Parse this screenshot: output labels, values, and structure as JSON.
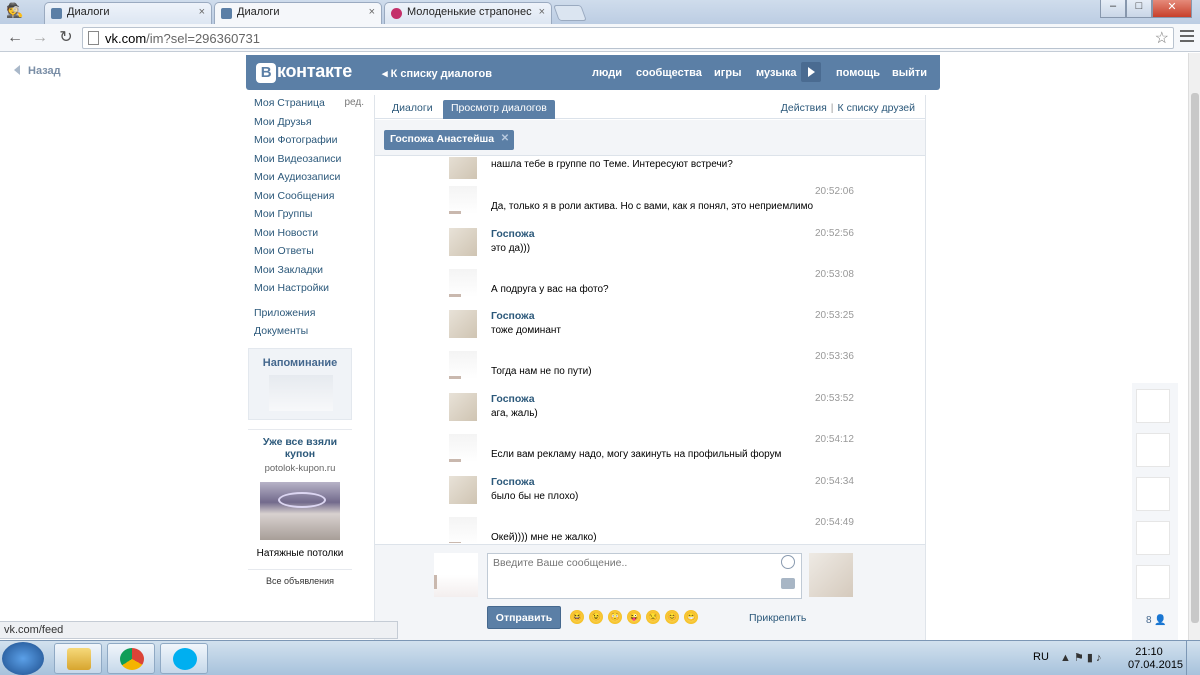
{
  "browser": {
    "tabs": [
      {
        "title": "Диалоги",
        "icon": "vk-favicon"
      },
      {
        "title": "Диалоги",
        "icon": "vk-favicon",
        "active": true
      },
      {
        "title": "Молоденькие страпонес",
        "icon": "pink-favicon"
      }
    ],
    "tab_close": "×",
    "url_host": "vk.com",
    "url_rest": "/im?sel=296360731",
    "window_controls": {
      "minimize": "–",
      "maximize": "□",
      "close": "✕"
    }
  },
  "page": {
    "back_label": "Назад",
    "header": {
      "logo_letter": "B",
      "logo_text": "контакте",
      "back_to_dialogs": "К списку диалогов",
      "links": [
        "люди",
        "сообщества",
        "игры",
        "музыка",
        "помощь",
        "выйти"
      ]
    },
    "sidebar": {
      "items": [
        "Моя Страница",
        "Мои Друзья",
        "Мои Фотографии",
        "Мои Видеозаписи",
        "Мои Аудиозаписи",
        "Мои Сообщения",
        "Мои Группы",
        "Мои Новости",
        "Мои Ответы",
        "Мои Закладки",
        "Мои Настройки"
      ],
      "edit_label": "ред.",
      "extra": [
        "Приложения",
        "Документы"
      ]
    },
    "reminder": {
      "title": "Напоминание"
    },
    "ad": {
      "title": "Уже все взяли купон",
      "domain": "potolok-kupon.ru",
      "caption": "Натяжные потолки",
      "all_ads": "Все объявления"
    },
    "dialog_tabs": {
      "tab1": "Диалоги",
      "tab2": "Просмотр диалогов",
      "actions": "Действия",
      "to_friends": "К списку друзей"
    },
    "peer": {
      "name": "Госпожа Анастейша",
      "close": "✕"
    },
    "messages": [
      {
        "author": "",
        "time": "",
        "text": "нашла тебе в группе по Теме. Интересуют встречи?",
        "peer": true
      },
      {
        "author": "",
        "time": "20:52:06",
        "text": "Да, только я в роли актива. Но с вами, как я понял, это неприемлимо",
        "peer": false
      },
      {
        "author": "Госпожа",
        "time": "20:52:56",
        "text": "это да)))",
        "peer": true
      },
      {
        "author": "",
        "time": "20:53:08",
        "text": "А подруга у вас на фото?",
        "peer": false
      },
      {
        "author": "Госпожа",
        "time": "20:53:25",
        "text": "тоже доминант",
        "peer": true
      },
      {
        "author": "",
        "time": "20:53:36",
        "text": "Тогда нам не по пути)",
        "peer": false
      },
      {
        "author": "Госпожа",
        "time": "20:53:52",
        "text": "ага, жаль)",
        "peer": true
      },
      {
        "author": "",
        "time": "20:54:12",
        "text": "Если вам рекламу надо, могу закинуть на профильный форум",
        "peer": false
      },
      {
        "author": "Госпожа",
        "time": "20:54:34",
        "text": "было бы не плохо)",
        "peer": true
      },
      {
        "author": "",
        "time": "20:54:49",
        "text": "Окей)))) мне не жалко)",
        "peer": false
      }
    ],
    "composer": {
      "placeholder": "Введите Ваше сообщение..",
      "send": "Отправить",
      "attach": "Прикрепить",
      "emojis": [
        "😆",
        "😉",
        "😳",
        "😜",
        "😒",
        "😊",
        "😁"
      ]
    },
    "right_strip": {
      "count": "8"
    }
  },
  "status_bar": "vk.com/feed",
  "taskbar": {
    "apps": [
      "explorer",
      "chrome",
      "skype"
    ],
    "lang": "RU",
    "time": "21:10",
    "date": "07.04.2015"
  },
  "colors": {
    "vk_blue": "#5b7fa6",
    "link": "#2b587a"
  }
}
